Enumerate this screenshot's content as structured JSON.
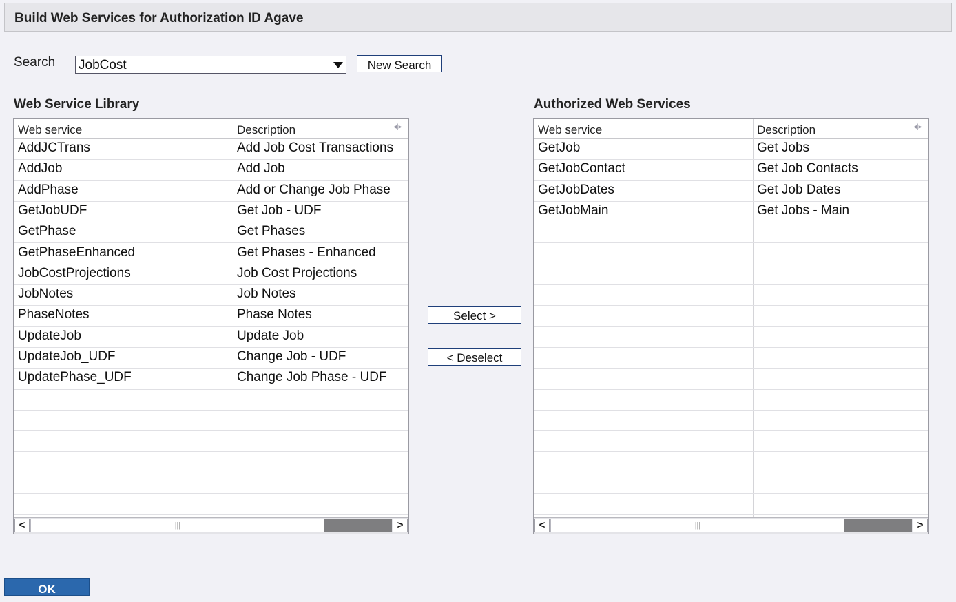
{
  "window": {
    "title": "Build Web Services for Authorization ID Agave"
  },
  "search": {
    "label": "Search",
    "value": "JobCost",
    "new_search_label": "New Search"
  },
  "library": {
    "heading": "Web Service Library",
    "columns": [
      "Web service",
      "Description"
    ],
    "rows": [
      [
        "AddJCTrans",
        "Add Job Cost Transactions"
      ],
      [
        "AddJob",
        "Add Job"
      ],
      [
        "AddPhase",
        "Add or Change Job Phase"
      ],
      [
        "GetJobUDF",
        "Get Job - UDF"
      ],
      [
        "GetPhase",
        "Get Phases"
      ],
      [
        "GetPhaseEnhanced",
        "Get Phases - Enhanced"
      ],
      [
        "JobCostProjections",
        "Job Cost Projections"
      ],
      [
        "JobNotes",
        "Job Notes"
      ],
      [
        "PhaseNotes",
        "Phase Notes"
      ],
      [
        "UpdateJob",
        "Update Job"
      ],
      [
        "UpdateJob_UDF",
        "Change Job - UDF"
      ],
      [
        "UpdatePhase_UDF",
        "Change Job Phase - UDF"
      ]
    ]
  },
  "authorized": {
    "heading": "Authorized Web Services",
    "columns": [
      "Web service",
      "Description"
    ],
    "rows": [
      [
        "GetJob",
        "Get Jobs"
      ],
      [
        "GetJobContact",
        "Get Job Contacts"
      ],
      [
        "GetJobDates",
        "Get Job Dates"
      ],
      [
        "GetJobMain",
        "Get Jobs - Main"
      ]
    ]
  },
  "actions": {
    "select_label": "Select >",
    "deselect_label": "< Deselect",
    "ok_label": "OK"
  },
  "icons": {
    "dropdown": "chevron-down-icon",
    "column_resize": "column-resize-icon",
    "scroll_left": "scroll-left-icon",
    "scroll_right": "scroll-right-icon"
  },
  "colors": {
    "ok_button": "#2b68ad",
    "background": "#f1f1f6"
  }
}
